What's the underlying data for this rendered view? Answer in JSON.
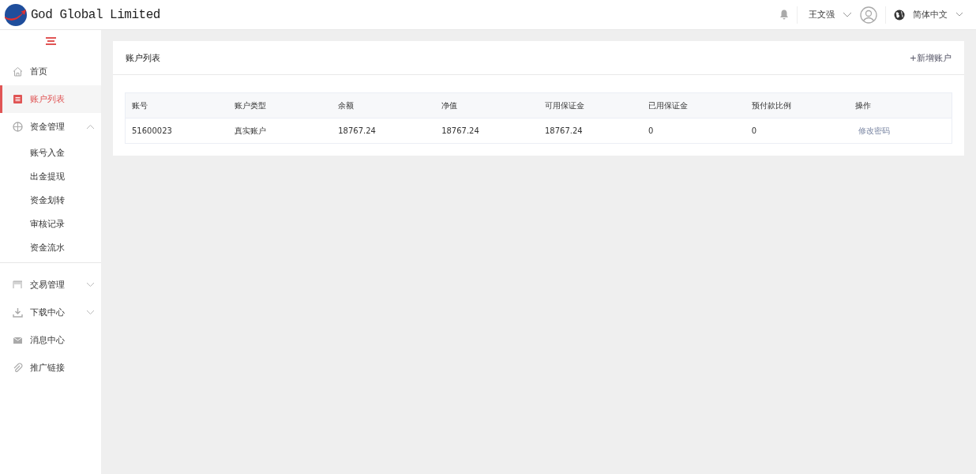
{
  "header": {
    "logo_text": "God Global Limited",
    "user": "王文强",
    "language": "简体中文"
  },
  "sidebar": {
    "items": [
      {
        "label": "首页",
        "selected": false
      },
      {
        "label": "账户列表",
        "selected": true
      },
      {
        "label": "资金管理",
        "selected": false,
        "expanded": true,
        "children": [
          {
            "label": "账号入金",
            "selected": false
          },
          {
            "label": "出金提现",
            "selected": false
          },
          {
            "label": "资金划转",
            "selected": false
          },
          {
            "label": "审核记录",
            "selected": false
          },
          {
            "label": "资金流水",
            "selected": false
          }
        ]
      },
      {
        "label": "交易管理",
        "selected": false,
        "expanded": false
      },
      {
        "label": "下载中心",
        "selected": false,
        "expanded": false
      },
      {
        "label": "消息中心",
        "selected": false
      },
      {
        "label": "推广链接",
        "selected": false
      }
    ]
  },
  "card": {
    "title": "账户列表",
    "action": "+新增账户"
  },
  "table": {
    "columns": [
      "账号",
      "账户类型",
      "余额",
      "净值",
      "可用保证金",
      "已用保证金",
      "预付款比例",
      "操作"
    ],
    "rows": [
      {
        "cells": [
          "51600023",
          "真实账户",
          "18767.24",
          "18767.24",
          "18767.24",
          "0",
          "0"
        ],
        "action": "修改密码"
      }
    ]
  }
}
